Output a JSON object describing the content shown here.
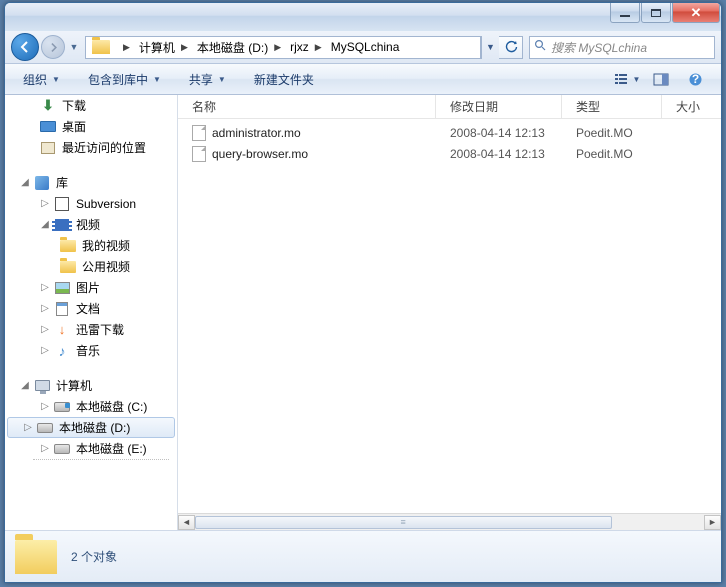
{
  "breadcrumbs": [
    "计算机",
    "本地磁盘 (D:)",
    "rjxz",
    "MySQLchina"
  ],
  "search": {
    "placeholder": "搜索 MySQLchina"
  },
  "toolbar": {
    "organize": "组织",
    "include": "包含到库中",
    "share": "共享",
    "newfolder": "新建文件夹"
  },
  "nav": {
    "downloads": "下载",
    "desktop": "桌面",
    "recent": "最近访问的位置",
    "libraries": "库",
    "subversion": "Subversion",
    "videos": "视频",
    "myvideos": "我的视频",
    "publicvideos": "公用视频",
    "pictures": "图片",
    "documents": "文档",
    "xunlei": "迅雷下载",
    "music": "音乐",
    "computer": "计算机",
    "drive_c": "本地磁盘 (C:)",
    "drive_d": "本地磁盘 (D:)",
    "drive_e": "本地磁盘 (E:)"
  },
  "columns": {
    "name": "名称",
    "date": "修改日期",
    "type": "类型",
    "size": "大小"
  },
  "files": [
    {
      "name": "administrator.mo",
      "date": "2008-04-14 12:13",
      "type": "Poedit.MO"
    },
    {
      "name": "query-browser.mo",
      "date": "2008-04-14 12:13",
      "type": "Poedit.MO"
    }
  ],
  "status": {
    "count": "2 个对象"
  }
}
